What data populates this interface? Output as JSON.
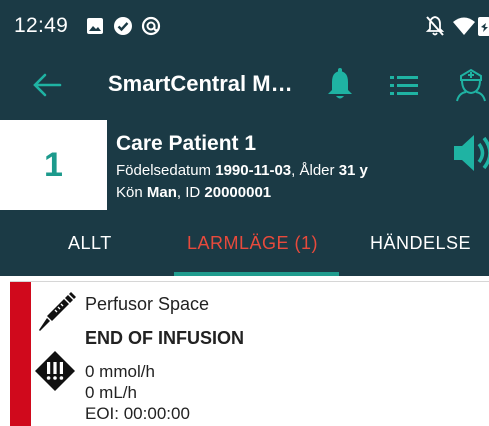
{
  "status_bar": {
    "time": "12:49",
    "icons": [
      "image-icon",
      "check-circle-icon",
      "at-sign-icon",
      "notifications-off-icon",
      "wifi-icon",
      "battery-icon"
    ]
  },
  "toolbar": {
    "title": "SmartCentral M…",
    "icons": [
      "back-arrow-icon",
      "bell-icon",
      "list-icon",
      "nurse-icon"
    ],
    "bell_color": "#1fb3a3"
  },
  "patient": {
    "bed_number": "1",
    "name": "Care Patient 1",
    "dob_label": "Födelsedatum",
    "dob_value": "1990-11-03",
    "age_label": "Ålder",
    "age_value": "31 y",
    "sex_label": "Kön",
    "sex_value": "Man",
    "id_label": "ID",
    "id_value": "20000001"
  },
  "tabs": [
    {
      "label": "ALLT",
      "active": false
    },
    {
      "label": "LARMLÄGE (1)",
      "active": true
    },
    {
      "label": "HÄNDELSE",
      "active": false
    }
  ],
  "alarm": {
    "device": "Perfusor Space",
    "title": "END OF INFUSION",
    "readings": [
      "0 mmol/h",
      "0 mL/h",
      "EOI: 00:00:00"
    ],
    "severity_color": "#d0091c"
  },
  "colors": {
    "header_bg": "#1b3a45",
    "accent": "#1f9c8e",
    "active_tab": "#e84a3c"
  }
}
